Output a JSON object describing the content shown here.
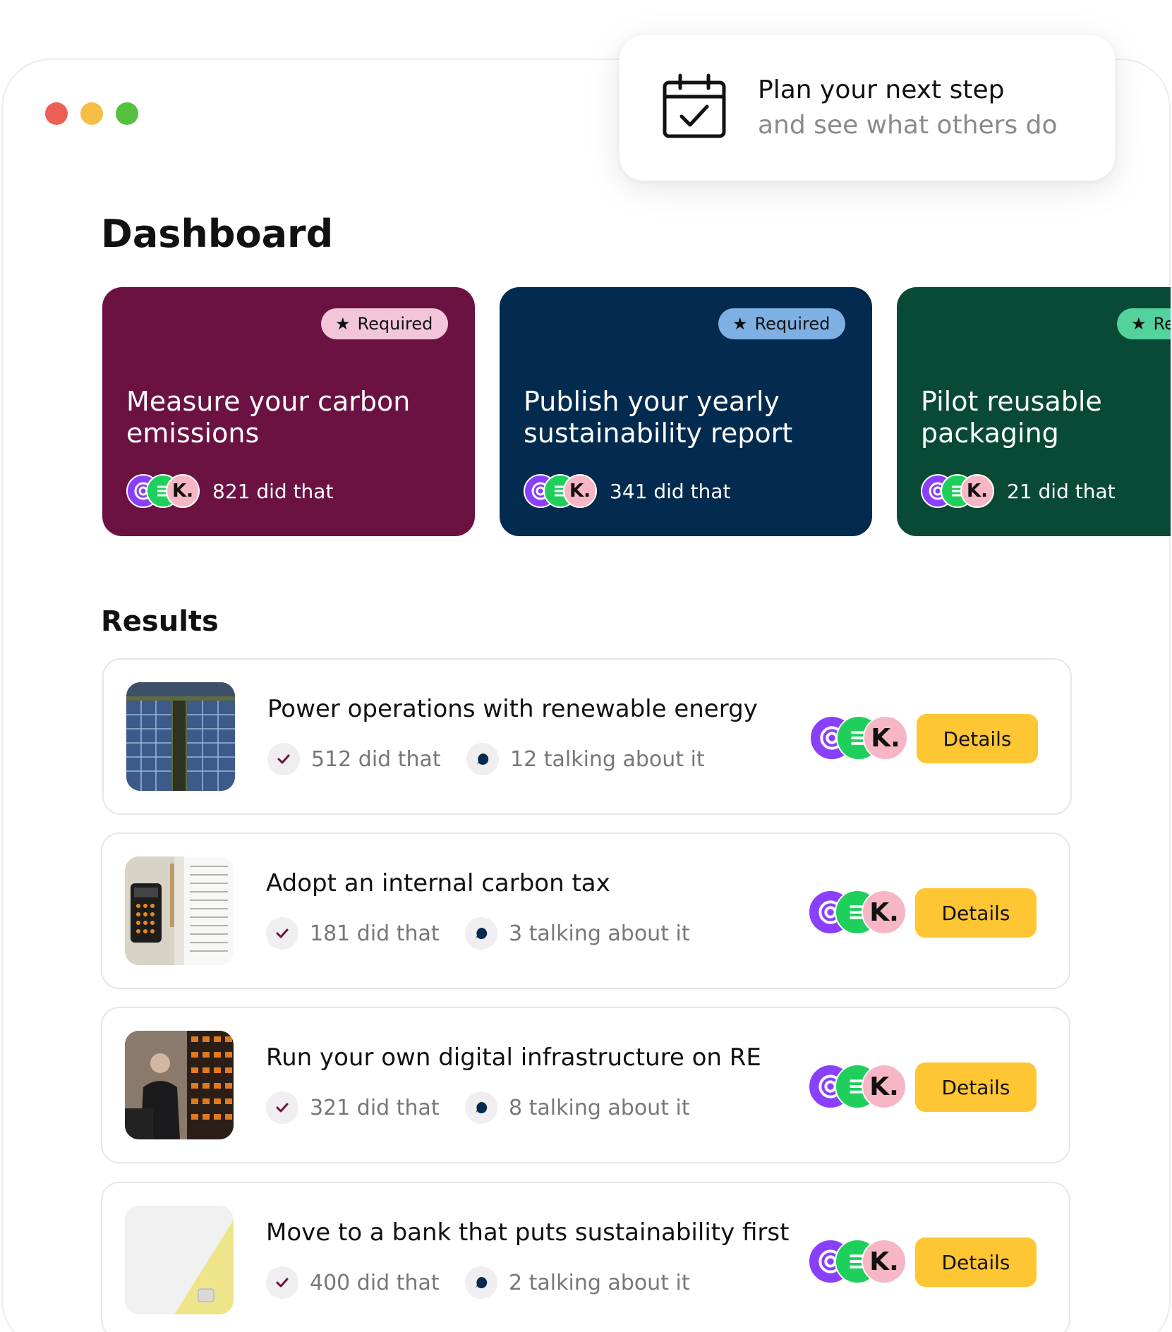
{
  "window_controls": {
    "close_color": "#ec5f56",
    "minimize_color": "#f4bf44",
    "maximize_color": "#56c03f"
  },
  "popup": {
    "icon": "calendar-check-icon",
    "title": "Plan your next step",
    "subtitle": "and see what others do"
  },
  "page_title": "Dashboard",
  "cards": [
    {
      "badge": "Required",
      "title": "Measure your carbon emissions",
      "count": "821 did that",
      "bg": "#6b1242",
      "badge_bg": "#f2c6d8"
    },
    {
      "badge": "Required",
      "title": "Publish your yearly sustainability report",
      "count": "341 did that",
      "bg": "#032a4f",
      "badge_bg": "#7fb0e3"
    },
    {
      "badge": "Re",
      "title": "Pilot reusable packaging",
      "count": "21 did that",
      "bg": "#084a35",
      "badge_bg": "#54d29e"
    }
  ],
  "results_title": "Results",
  "results": [
    {
      "title": "Power operations with renewable energy",
      "did": "512 did that",
      "talking": "12 talking about it",
      "button": "Details",
      "thumb": "solar-panels-image"
    },
    {
      "title": "Adopt an internal carbon tax",
      "did": "181 did that",
      "talking": "3 talking about it",
      "button": "Details",
      "thumb": "calculator-tax-form-image"
    },
    {
      "title": "Run your own digital infrastructure on RE",
      "did": "321 did that",
      "talking": "8 talking about it",
      "button": "Details",
      "thumb": "server-room-image"
    },
    {
      "title": "Move to a bank that puts sustainability first",
      "did": "400 did that",
      "talking": "2 talking about it",
      "button": "Details",
      "thumb": "bank-card-image"
    }
  ],
  "avatar_letter": "K.",
  "colors": {
    "button_yellow": "#fdc632",
    "avatar_purple": "#8a3ffc",
    "avatar_green": "#1fcf5c",
    "avatar_pink": "#f7b6c5"
  }
}
